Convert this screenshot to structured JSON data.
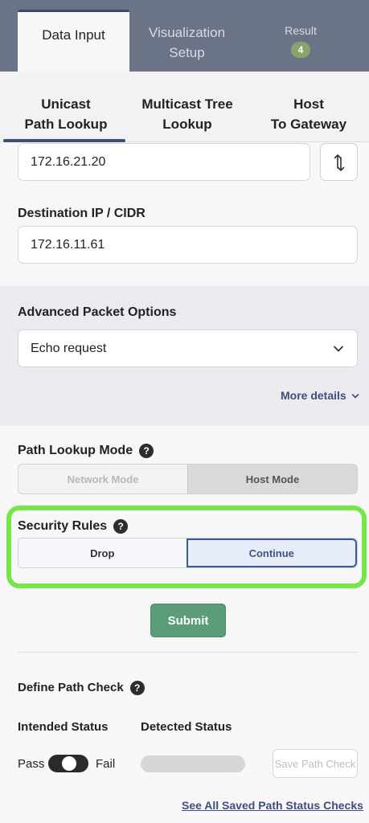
{
  "top_tabs": {
    "data_input": "Data Input",
    "visualization_line1": "Visualization",
    "visualization_line2": "Setup",
    "result": "Result",
    "result_badge": "4"
  },
  "sub_tabs": {
    "unicast_line1": "Unicast",
    "unicast_line2": "Path Lookup",
    "multicast_line1": "Multicast Tree",
    "multicast_line2": "Lookup",
    "host_line1": "Host",
    "host_line2": "To Gateway"
  },
  "form": {
    "source_ip_value": "172.16.21.20",
    "destination_label": "Destination IP / CIDR",
    "destination_value": "172.16.11.61",
    "advanced_label": "Advanced Packet Options",
    "advanced_selected": "Echo request",
    "more_details": "More details",
    "path_mode_label": "Path Lookup Mode",
    "path_mode_options": [
      "Network Mode",
      "Host Mode"
    ],
    "security_label": "Security Rules",
    "security_options": [
      "Drop",
      "Continue"
    ],
    "submit": "Submit"
  },
  "path_check": {
    "title": "Define Path Check",
    "intended_status": "Intended Status",
    "detected_status": "Detected Status",
    "pass": "Pass",
    "fail": "Fail",
    "save_button": "Save Path Check",
    "see_all_link": "See All Saved Path Status Checks"
  },
  "colors": {
    "header": "#6b7487",
    "submit": "#5b9c79",
    "highlight": "#74e84b",
    "link": "#3d4f7c"
  }
}
